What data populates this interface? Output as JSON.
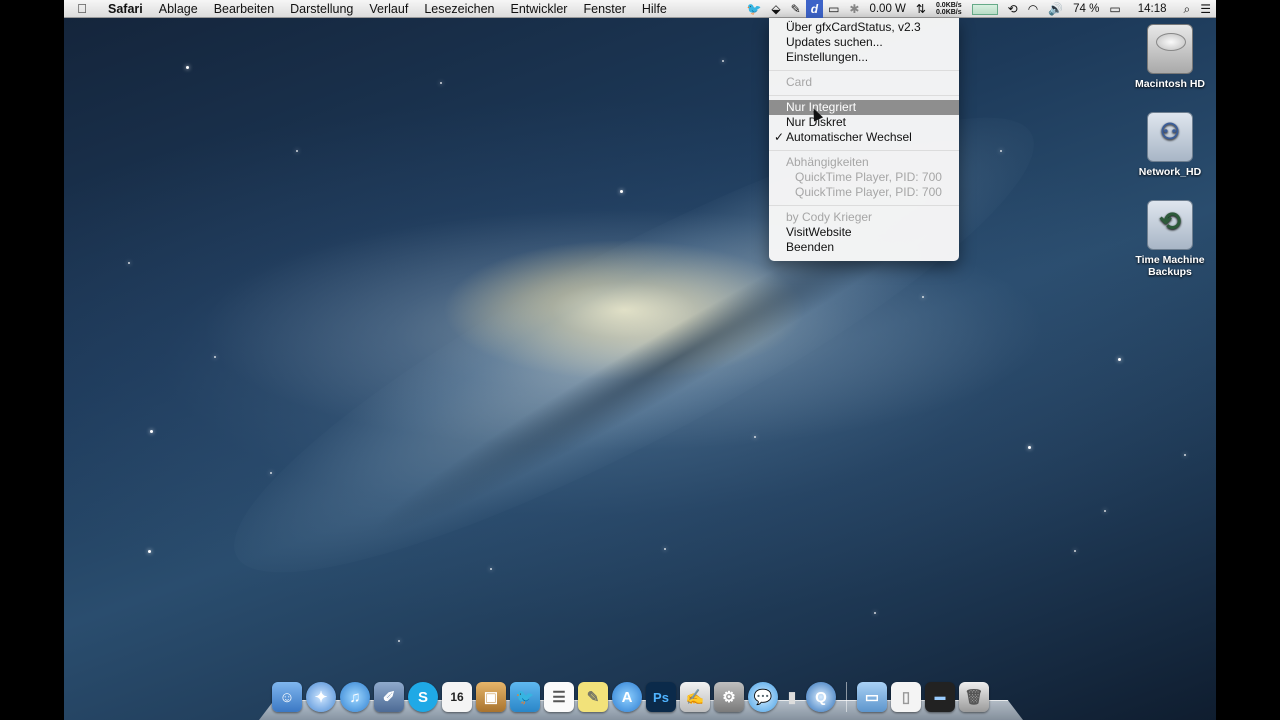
{
  "menubar": {
    "app_name": "Safari",
    "menus": [
      "Ablage",
      "Bearbeiten",
      "Darstellung",
      "Verlauf",
      "Lesezeichen",
      "Entwickler",
      "Fenster",
      "Hilfe"
    ],
    "status": {
      "power_reading": "0.00 W",
      "net_up": "0.0KB/s",
      "net_down": "0.0KB/s",
      "battery_percent": "74 %",
      "clock": "14:18",
      "gfx_icon_glyph": "d"
    }
  },
  "dropdown": {
    "about": "Über gfxCardStatus, v2.3",
    "check_updates": "Updates suchen...",
    "preferences": "Einstellungen...",
    "card_header": "Card",
    "integrated_only": "Nur Integriert",
    "discrete_only": "Nur Diskret",
    "dynamic_switching": "Automatischer Wechsel",
    "dependencies_header": "Abhängigkeiten",
    "dependencies": [
      "QuickTime Player, PID: 700",
      "QuickTime Player, PID: 700"
    ],
    "author": "by Cody Krieger",
    "visit_website": "VisitWebsite",
    "quit": "Beenden",
    "checkmark": "✓"
  },
  "desktop": {
    "icons": [
      "Macintosh HD",
      "Network_HD",
      "Time Machine Backups"
    ]
  },
  "dock": {
    "calendar_day": "16",
    "ps_label": "Ps",
    "skype_label": "S"
  },
  "colors": {
    "menu_highlight": "#8e8e8e",
    "status_active": "#3d63c8",
    "menubar_bg": "#e6e6e6"
  }
}
